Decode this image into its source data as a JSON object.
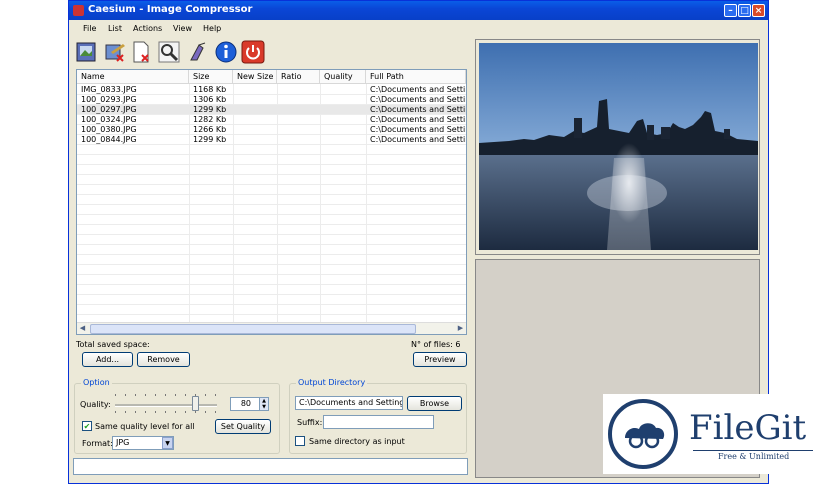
{
  "window": {
    "title": "Caesium - Image Compressor"
  },
  "menu": [
    "File",
    "List",
    "Actions",
    "View",
    "Help"
  ],
  "toolbar": {
    "icons": [
      "add-images-icon",
      "clear-list-icon",
      "remove-item-icon",
      "search-preview-icon",
      "compress-icon",
      "info-icon",
      "power-exit-icon"
    ]
  },
  "columns": [
    "Name",
    "Size",
    "New Size",
    "Ratio",
    "Quality",
    "Full Path"
  ],
  "rows": [
    {
      "name": "IMG_0833.JPG",
      "size": "1168 Kb",
      "new_size": "",
      "ratio": "",
      "quality": "",
      "path": "C:\\Documents and Settings"
    },
    {
      "name": "100_0293.JPG",
      "size": "1306 Kb",
      "new_size": "",
      "ratio": "",
      "quality": "",
      "path": "C:\\Documents and Settings"
    },
    {
      "name": "100_0297.JPG",
      "size": "1299 Kb",
      "new_size": "",
      "ratio": "",
      "quality": "",
      "path": "C:\\Documents and Settings"
    },
    {
      "name": "100_0324.JPG",
      "size": "1282 Kb",
      "new_size": "",
      "ratio": "",
      "quality": "",
      "path": "C:\\Documents and Settings"
    },
    {
      "name": "100_0380.JPG",
      "size": "1266 Kb",
      "new_size": "",
      "ratio": "",
      "quality": "",
      "path": "C:\\Documents and Settings"
    },
    {
      "name": "100_0844.JPG",
      "size": "1299 Kb",
      "new_size": "",
      "ratio": "",
      "quality": "",
      "path": "C:\\Documents and Settings"
    }
  ],
  "selected_row": 2,
  "list_footer": {
    "saved_label": "Total saved space:",
    "count_label": "N° of files: 6"
  },
  "buttons": {
    "add": "Add...",
    "remove": "Remove",
    "preview": "Preview",
    "set_quality": "Set Quality",
    "browse": "Browse"
  },
  "option": {
    "legend": "Option",
    "quality_label": "Quality:",
    "quality_value": "80",
    "same_quality_label": "Same quality level for all",
    "same_quality_checked": true,
    "format_label": "Format:",
    "format_value": "JPG"
  },
  "output": {
    "legend": "Output Directory",
    "directory": "C:\\Documents and Settings\\",
    "suffix_label": "Suffix:",
    "suffix_value": "",
    "same_dir_label": "Same directory as input",
    "same_dir_checked": false
  },
  "watermark": {
    "brand": "FileGit",
    "tagline": "Free & Unlimited"
  },
  "colors": {
    "accent": "#0a46d6",
    "legend": "#0046d5",
    "brand": "#1f3f6e"
  }
}
